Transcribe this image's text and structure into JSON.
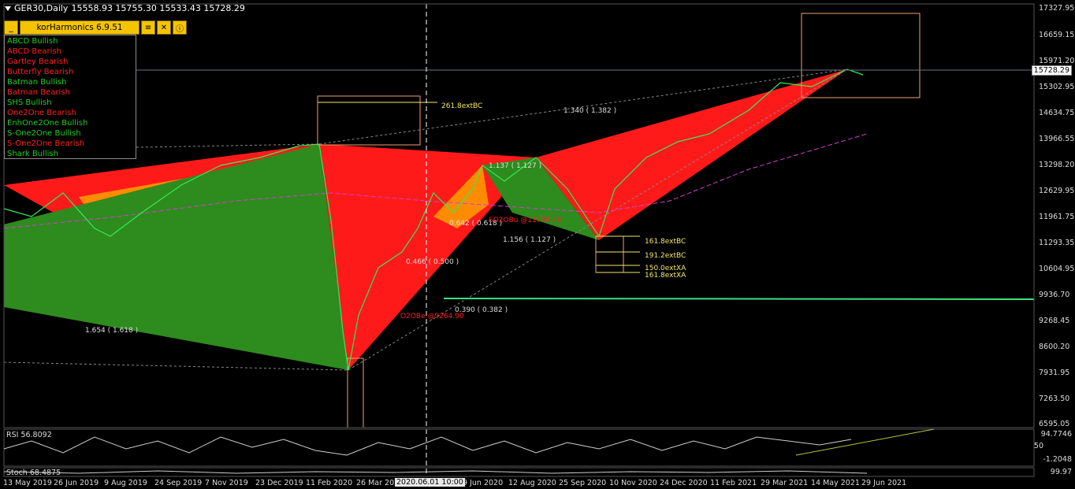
{
  "header": {
    "symbol_text": "GER30,Daily",
    "ohlc_text": "15558.93 15755.30 15533.43 15728.29"
  },
  "toolbar": {
    "minimize_label": "_",
    "title": "korHarmonics 6.9.51",
    "settings_icon": "sliders-icon",
    "tools_icon": "tools-icon",
    "info_icon": "info-icon"
  },
  "legend": [
    {
      "label": "ABCD Bullish",
      "color": "#22cc22"
    },
    {
      "label": "ABCD Bearish",
      "color": "#ff2020"
    },
    {
      "label": "Gartley Bearish",
      "color": "#ff2020"
    },
    {
      "label": "Butterfly Bearish",
      "color": "#ff2020"
    },
    {
      "label": "Batman Bullish",
      "color": "#22cc22"
    },
    {
      "label": "Batman Bearish",
      "color": "#ff2020"
    },
    {
      "label": "SHS Bullish",
      "color": "#22cc22"
    },
    {
      "label": "One2One Bearish",
      "color": "#ff2020"
    },
    {
      "label": "EnhOne2One Bullish",
      "color": "#22cc22"
    },
    {
      "label": "S-One2One Bullish",
      "color": "#22cc22"
    },
    {
      "label": "S-One2One Bearish",
      "color": "#ff2020"
    },
    {
      "label": "Shark Bullish",
      "color": "#22cc22"
    }
  ],
  "price_axis": [
    "17327.95",
    "16659.15",
    "15971.20",
    "15302.95",
    "14634.75",
    "13966.55",
    "13298.20",
    "12629.95",
    "11961.75",
    "11293.35",
    "10604.95",
    "9936.70",
    "9268.45",
    "8600.20",
    "7931.95",
    "7263.50",
    "6595.05"
  ],
  "current_price": "15728.29",
  "date_axis": [
    "13 May 2019",
    "26 Jun 2019",
    "9 Aug 2019",
    "24 Sep 2019",
    "7 Nov 2019",
    "23 Dec 2019",
    "11 Feb 2020",
    "26 Mar 2020",
    "29 Jun 2020",
    "12 Aug 2020",
    "25 Sep 2020",
    "10 Nov 2020",
    "24 Dec 2020",
    "11 Feb 2021",
    "29 Mar 2021",
    "14 May 2021",
    "29 Jun 2021"
  ],
  "crosshair_date": "2020.06.01 10:00",
  "annotations": {
    "ext_261": "261.8extBC",
    "ext_1618bc": "161.8extBC",
    "ext_1912bc": "191.2extBC",
    "ext_150xa": "150.0extXA",
    "ext_1618xa": "161.8extXA",
    "ratio_1340": "1.340 ( 1.382 )",
    "ratio_1137": "1.137 ( 1.127 )",
    "ratio_0642": "0.642 ( 0.618 )",
    "ratio_1156": "1.156 ( 1.127 )",
    "ratio_0466": "0.466 ( 0.500 )",
    "ratio_0390": "0.390 ( 0.382 )",
    "ratio_1654": "1.654 ( 1.618 )",
    "so2ob": "SO2OBu  @11755.45",
    "o2ob": "O2OBe  @9264.90"
  },
  "rsi": {
    "label": "RSI 56.8092",
    "top_value": "94.7746",
    "mid_value": "50",
    "bottom_value": "-1.2048"
  },
  "stoch": {
    "label": "Stoch 68.4875",
    "value": "99.97"
  }
}
